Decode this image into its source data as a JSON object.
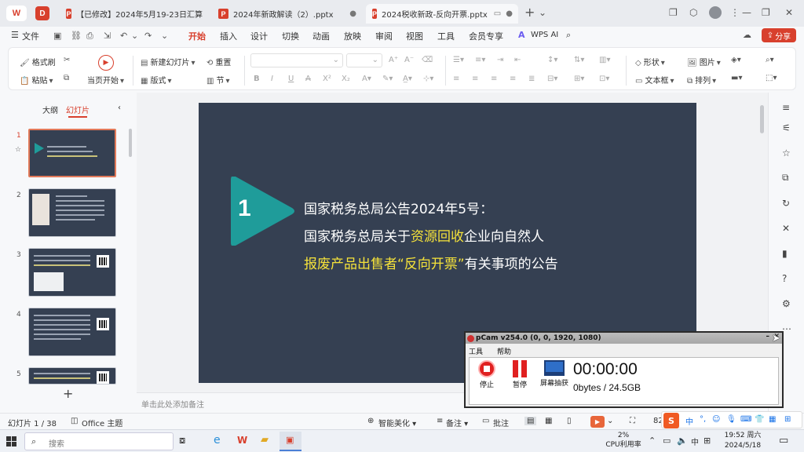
{
  "titlebar": {
    "tabs": [
      {
        "label": "【已修改】2024年5月19-23日汇算",
        "active": false
      },
      {
        "label": "2024年新政解读（2）.pptx",
        "active": false
      },
      {
        "label": "2024税收新政-反向开票.pptx",
        "active": true
      }
    ],
    "new_tab": "+",
    "avatar": "user-avatar"
  },
  "menubar": {
    "file": "文件",
    "items": [
      "开始",
      "插入",
      "设计",
      "切换",
      "动画",
      "放映",
      "审阅",
      "视图",
      "工具",
      "会员专享",
      "WPS AI"
    ],
    "share": "分享"
  },
  "ribbon": {
    "format_painter": "格式刷",
    "paste": "粘贴",
    "play_from_current": "当页开始",
    "new_slide": "新建幻灯片",
    "reset": "重置",
    "layout": "版式",
    "section": "节",
    "shape": "形状",
    "picture": "图片",
    "textbox": "文本框",
    "arrange": "排列"
  },
  "leftpanel": {
    "outline_tab": "大纲",
    "slides_tab": "幻灯片",
    "slide_numbers": [
      "1",
      "2",
      "3",
      "4",
      "5"
    ],
    "add": "+"
  },
  "slide": {
    "number": "1",
    "line1": "国家税务总局公告2024年5号：",
    "line2_a": "国家税务总局关于",
    "line2_hl": "资源回收",
    "line2_b": "企业向自然人",
    "line3_hl": "报废产品出售者“反向开票”",
    "line3_b": "有关事项的公告"
  },
  "notes": {
    "placeholder": "单击此处添加备注"
  },
  "statusbar": {
    "slide_count": "幻灯片 1 / 38",
    "theme": "Office 主题",
    "smart_beautify": "智能美化",
    "notes_btn": "备注",
    "comments_btn": "批注",
    "zoom": "82"
  },
  "taskbar": {
    "search_placeholder": "搜索",
    "cpu_percent": "2%",
    "cpu_label": "CPU利用率",
    "ime": "中",
    "time": "19:52 周六",
    "date": "2024/5/18"
  },
  "bandicam": {
    "title": "pCam v254.0 (0, 0, 1920, 1080)",
    "menu_tools": "工具",
    "menu_help": "帮助",
    "stop": "停止",
    "pause": "暂停",
    "screenshot": "屏幕抽获",
    "timer": "00:00:00",
    "size": "0bytes / 24.5GB"
  },
  "colors": {
    "accent": "#d8402d",
    "slide_bg": "#354052",
    "slide_arrow": "#1f9c9a",
    "highlight": "#f5e23a"
  }
}
